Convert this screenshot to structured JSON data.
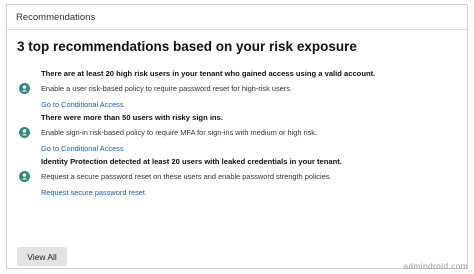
{
  "card": {
    "header_title": "Recommendations"
  },
  "main_title": "3 top recommendations based on your risk exposure",
  "recommendations": [
    {
      "icon": "user-risk-icon",
      "heading": "There are at least 20 high risk users in your tenant who gained access using a valid account.",
      "description": "Enable a user risk-based policy to require password reset for high-risk users.",
      "link": "Go to Conditional Access"
    },
    {
      "icon": "user-risk-icon",
      "heading": "There were more than 50 users with risky sign ins.",
      "description": "Enable sign-in risk-based policy to require MFA for sign-ins with medium or high risk.",
      "link": "Go to Conditional Access"
    },
    {
      "icon": "user-risk-icon",
      "heading": "Identity Protection detected at least 20 users with leaked credentials in your tenant.",
      "description": "Request a secure password reset on these users and enable password strength policies.",
      "link": "Request secure password reset"
    }
  ],
  "footer": {
    "view_all_label": "View All"
  },
  "watermark": "admindroid.com",
  "colors": {
    "icon": "#2e8b80",
    "link": "#1a5fb4",
    "button_bg": "#e3e3e3"
  }
}
